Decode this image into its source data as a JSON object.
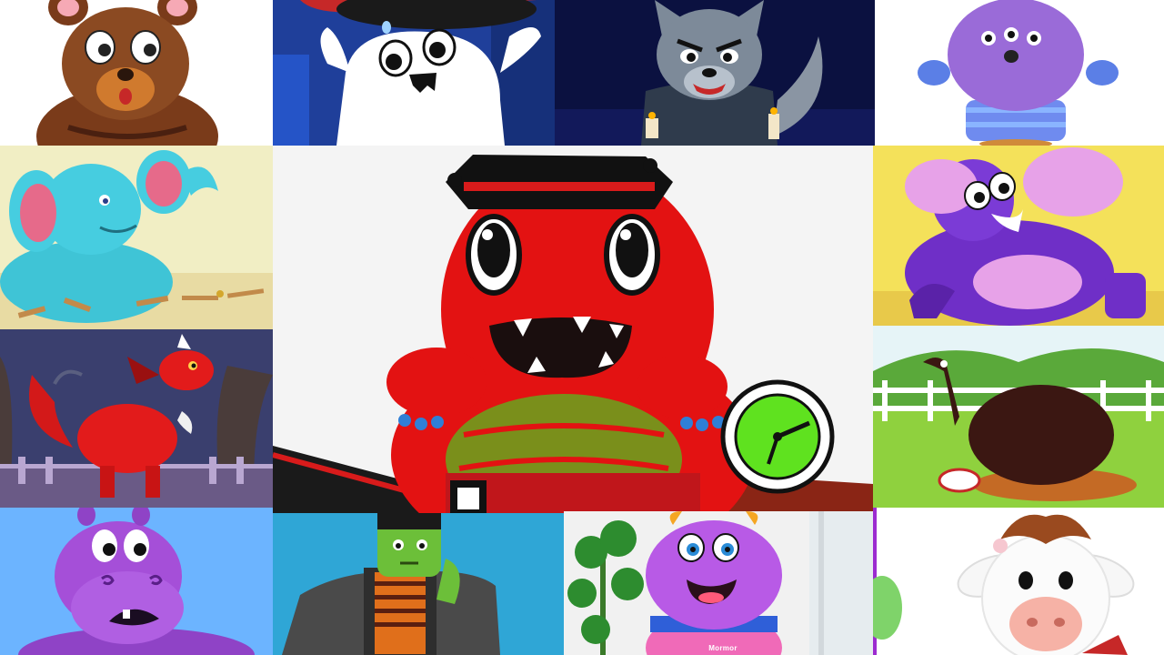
{
  "collage": {
    "tiles": [
      {
        "name": "tile-bear"
      },
      {
        "name": "tile-ghost"
      },
      {
        "name": "tile-wolf"
      },
      {
        "name": "tile-purple-monster"
      },
      {
        "name": "tile-blue-elephant"
      },
      {
        "name": "tile-red-dinosaur"
      },
      {
        "name": "tile-purple-elephant"
      },
      {
        "name": "tile-red-dragon"
      },
      {
        "name": "tile-emu"
      },
      {
        "name": "tile-purple-hippo"
      },
      {
        "name": "tile-frankenstein"
      },
      {
        "name": "tile-pink-monster"
      },
      {
        "name": "tile-cow"
      }
    ],
    "caption_mormor": "Mormor"
  }
}
